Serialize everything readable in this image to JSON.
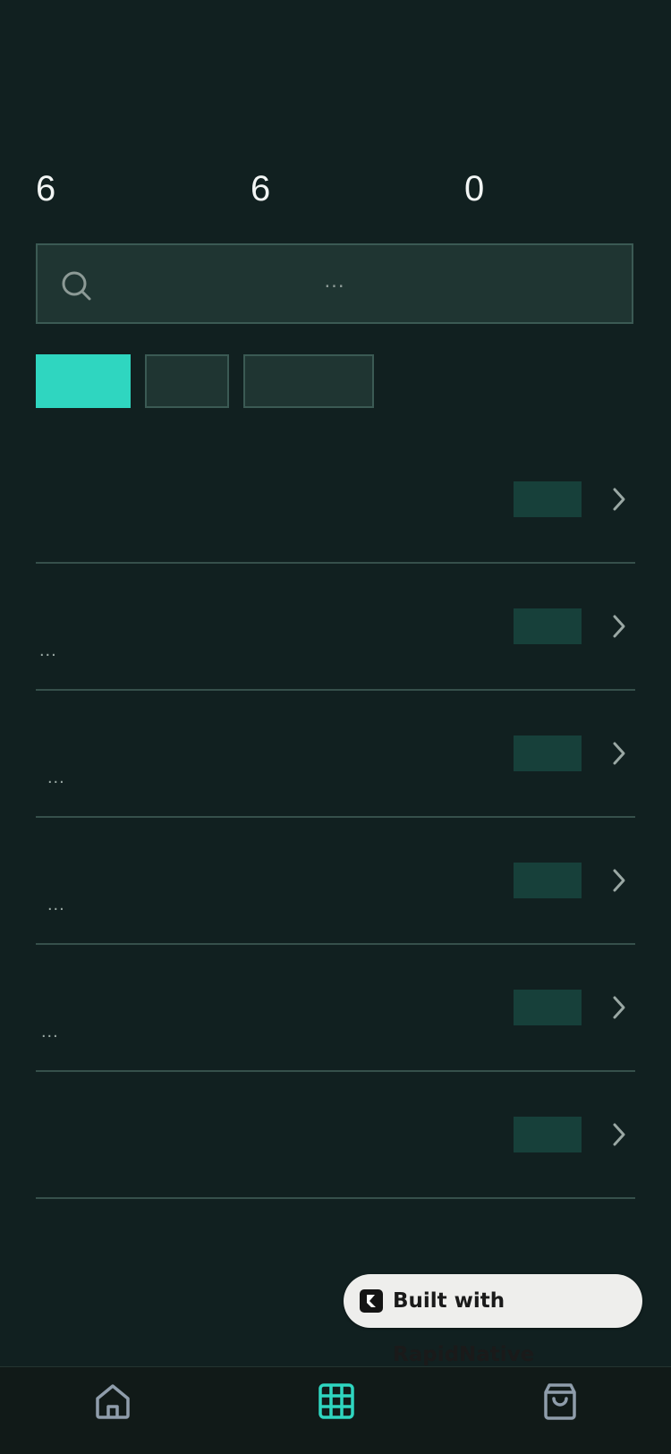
{
  "stats": [
    "6",
    "6",
    "0"
  ],
  "search": {
    "placeholder": "..."
  },
  "filters": [
    {
      "label": "",
      "active": true
    },
    {
      "label": "",
      "active": false
    },
    {
      "label": "",
      "active": false
    }
  ],
  "items": [
    {
      "subtitle": ""
    },
    {
      "subtitle": "..."
    },
    {
      "subtitle": "..."
    },
    {
      "subtitle": "..."
    },
    {
      "subtitle": "..."
    },
    {
      "subtitle": ""
    }
  ],
  "badge": {
    "text": "Built with RapidNative"
  },
  "nav": {
    "tabs": [
      {
        "icon": "home-icon",
        "active": false
      },
      {
        "icon": "grid-icon",
        "active": true
      },
      {
        "icon": "shopping-bag-icon",
        "active": false
      }
    ]
  },
  "colors": {
    "accent": "#2fd6c0",
    "background": "#112020",
    "surface": "#1f3532",
    "badge_bg": "#17403a"
  }
}
